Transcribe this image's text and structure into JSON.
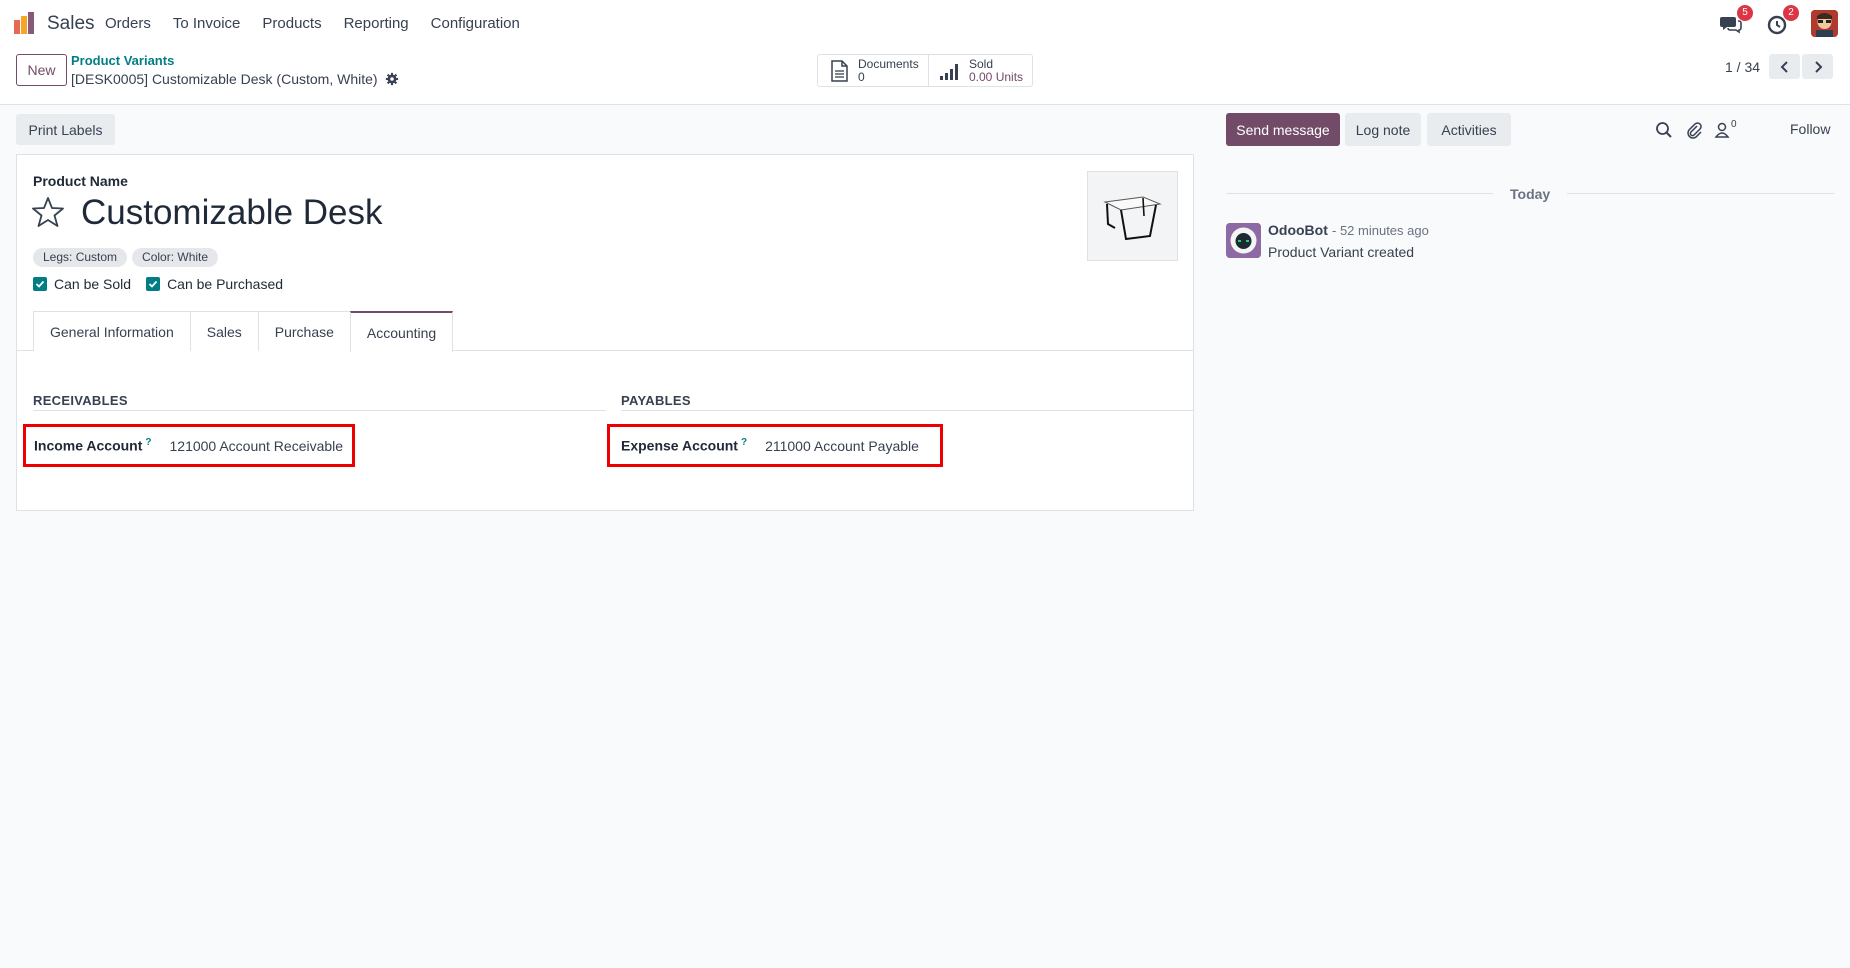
{
  "navbar": {
    "app_name": "Sales",
    "menu": [
      "Orders",
      "To Invoice",
      "Products",
      "Reporting",
      "Configuration"
    ],
    "messages_badge": "5",
    "activities_badge": "2"
  },
  "control_panel": {
    "new_label": "New",
    "breadcrumb": "Product Variants",
    "record_title": "[DESK0005] Customizable Desk (Custom, White)",
    "stats": {
      "documents_label": "Documents",
      "documents_value": "0",
      "sold_label": "Sold",
      "sold_value": "0.00 Units"
    },
    "pager": "1 / 34"
  },
  "statusbar": {
    "print_labels": "Print Labels"
  },
  "form": {
    "product_name_label": "Product Name",
    "product_name": "Customizable Desk",
    "tags": [
      "Legs: Custom",
      "Color: White"
    ],
    "can_be_sold": "Can be Sold",
    "can_be_purchased": "Can be Purchased",
    "tabs": [
      "General Information",
      "Sales",
      "Purchase",
      "Accounting"
    ],
    "active_tab": "Accounting",
    "receivables": {
      "title": "RECEIVABLES",
      "field_label": "Income Account",
      "help": "?",
      "value": "121000 Account Receivable"
    },
    "payables": {
      "title": "PAYABLES",
      "field_label": "Expense Account",
      "help": "?",
      "value": "211000 Account Payable"
    }
  },
  "chatter": {
    "send_message": "Send message",
    "log_note": "Log note",
    "activities": "Activities",
    "followers_count": "0",
    "follow": "Follow",
    "date_separator": "Today",
    "message": {
      "author": "OdooBot",
      "time": "- 52 minutes ago",
      "body": "Product Variant created"
    }
  },
  "colors": {
    "brand": "#714b67",
    "link": "#017e84",
    "highlight": "#ee0000"
  }
}
